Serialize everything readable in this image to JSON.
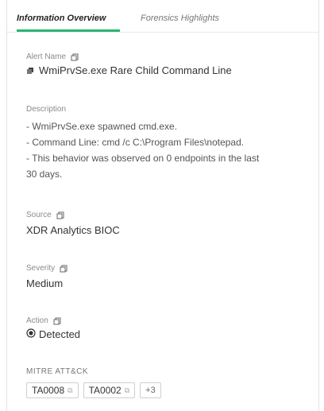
{
  "tabs": [
    {
      "label": "Information Overview",
      "active": true
    },
    {
      "label": "Forensics Highlights",
      "active": false
    }
  ],
  "alert_name": {
    "label": "Alert Name",
    "value": "WmiPrvSe.exe Rare Child Command Line"
  },
  "description": {
    "label": "Description",
    "lines": [
      "- WmiPrvSe.exe spawned cmd.exe.",
      "- Command Line: cmd /c C:\\Program Files\\notepad.",
      "- This behavior was observed on 0 endpoints in the last",
      "30 days."
    ]
  },
  "source": {
    "label": "Source",
    "value": "XDR Analytics BIOC"
  },
  "severity": {
    "label": "Severity",
    "value": "Medium"
  },
  "action": {
    "label": "Action",
    "value": "Detected"
  },
  "mitre": {
    "label": "MITRE ATT&CK",
    "tags": [
      "TA0008",
      "TA0002"
    ],
    "more": "+3"
  },
  "colors": {
    "accent": "#2bb673"
  }
}
